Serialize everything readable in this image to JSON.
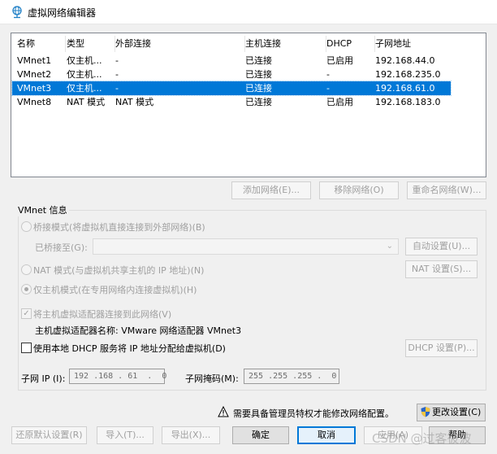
{
  "window": {
    "title": "虚拟网络编辑器"
  },
  "networks": {
    "columns": [
      "名称",
      "类型",
      "外部连接",
      "主机连接",
      "DHCP",
      "子网地址"
    ],
    "rows": [
      [
        "VMnet1",
        "仅主机...",
        "-",
        "已连接",
        "已启用",
        "192.168.44.0"
      ],
      [
        "VMnet2",
        "仅主机...",
        "-",
        "已连接",
        "-",
        "192.168.235.0"
      ],
      [
        "VMnet3",
        "仅主机...",
        "-",
        "已连接",
        "-",
        "192.168.61.0"
      ],
      [
        "VMnet8",
        "NAT 模式",
        "NAT 模式",
        "已连接",
        "已启用",
        "192.168.183.0"
      ]
    ],
    "selected_index": 2
  },
  "list_buttons": {
    "add": "添加网络(E)...",
    "remove": "移除网络(O)",
    "rename": "重命名网络(W)..."
  },
  "vmnet_info": {
    "group_label": "VMnet 信息",
    "bridge_mode": "桥接模式(将虚拟机直接连接到外部网络)(B)",
    "bridged_to_label": "已桥接至(G):",
    "auto_settings": "自动设置(U)...",
    "nat_mode": "NAT 模式(与虚拟机共享主机的 IP 地址)(N)",
    "nat_settings": "NAT 设置(S)...",
    "host_only_mode": "仅主机模式(在专用网络内连接虚拟机)(H)",
    "connect_adapter": "将主机虚拟适配器连接到此网络(V)",
    "adapter_name_label": "主机虚拟适配器名称: VMware 网络适配器 VMnet3",
    "use_dhcp": "使用本地 DHCP 服务将 IP 地址分配给虚拟机(D)",
    "dhcp_settings": "DHCP 设置(P)...",
    "subnet_ip_label": "子网 IP (I):",
    "subnet_ip_value": "192 .168 . 61  .  0",
    "subnet_mask_label": "子网掩码(M):",
    "subnet_mask_value": "255 .255 .255 .  0"
  },
  "footer": {
    "admin_notice": "需要具备管理员特权才能修改网络配置。",
    "change_settings": "更改设置(C)",
    "restore_defaults": "还原默认设置(R)",
    "import": "导入(T)...",
    "export": "导出(X)...",
    "ok": "确定",
    "cancel": "取消",
    "apply": "应用(A)",
    "help": "帮助"
  },
  "watermark": "CSDN @过客彼波",
  "colors": {
    "selection": "#0078d7",
    "accent": "#0078d7"
  }
}
